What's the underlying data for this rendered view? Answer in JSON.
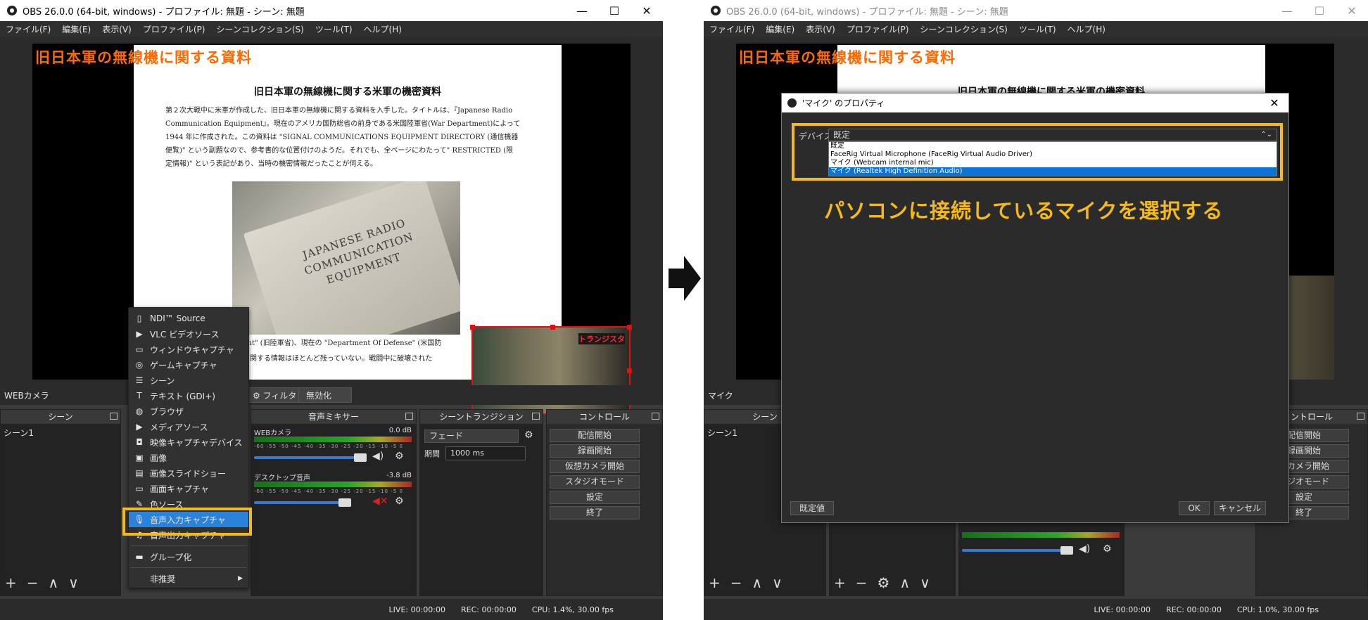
{
  "left": {
    "window_title": "OBS 26.0.0 (64-bit, windows) - プロファイル: 無題 - シーン: 無題",
    "menu": [
      "ファイル(F)",
      "編集(E)",
      "表示(V)",
      "プロファイル(P)",
      "シーンコレクション(S)",
      "ツール(T)",
      "ヘルプ(H)"
    ],
    "overlay_title": "旧日本軍の無線機に関する資料",
    "doc_title": "旧日本軍の無線機に関する米軍の機密資料",
    "doc_lines": [
      "第２次大戦中に米軍が作成した、旧日本軍の無線機に関する資料を入手した。タイトルは、『Japanese Radio",
      "Communication Equipment』。現在のアメリカ国防総省の前身である米国陸軍省(War Department)によって",
      "1944 年に作成された。この資料は \"SIGNAL COMMUNICATIONS EQUIPMENT DIRECTORY (通信機器",
      "便覧)\" という副題なので、参考書的な位置付けのようだ。それでも、全ページにわたって\" RESTRICTED (限",
      "定情報)\" という表記があり、当時の機密情報だったことが伺える。"
    ],
    "photo_text": "JAPANESE RADIO COMMUNICATION EQUIPMENT",
    "doc_bottom_1": "partment\" (旧陸軍省)、現在の \"Department Of Defense\" (米国防",
    "doc_bottom_2": "無線機に関する情報はほとんど残っていない。戦闘中に破壊された",
    "webcam_label": "トランジスタ",
    "source_name": "WEBカメラ",
    "filter_btn": "フィルタ",
    "disable_btn": "無効化",
    "scenes_hdr": "シーン",
    "scene_item": "シーン1",
    "mixer_hdr": "音声ミキサー",
    "mixer": [
      {
        "name": "WEBカメラ",
        "db": "0.0 dB"
      },
      {
        "name": "デスクトップ音声",
        "db": "-3.8 dB"
      }
    ],
    "meter_scale": "-60 -55 -50 -45 -40 -35 -30 -25 -20 -15 -10 -5 0",
    "trans_hdr": "シーントランジション",
    "trans_value": "フェード",
    "duration_label": "期間",
    "duration_value": "1000 ms",
    "ctrl_hdr": "コントロール",
    "controls": [
      "配信開始",
      "録画開始",
      "仮想カメラ開始",
      "スタジオモード",
      "設定",
      "終了"
    ],
    "context_menu": [
      {
        "icon": "▯",
        "label": "NDI™ Source"
      },
      {
        "icon": "▶",
        "label": "VLC ビデオソース"
      },
      {
        "icon": "▭",
        "label": "ウィンドウキャプチャ"
      },
      {
        "icon": "◎",
        "label": "ゲームキャプチャ"
      },
      {
        "icon": "☰",
        "label": "シーン"
      },
      {
        "icon": "T",
        "label": "テキスト (GDI+)"
      },
      {
        "icon": "◍",
        "label": "ブラウザ"
      },
      {
        "icon": "▶",
        "label": "メディアソース"
      },
      {
        "icon": "◘",
        "label": "映像キャプチャデバイス"
      },
      {
        "icon": "▣",
        "label": "画像"
      },
      {
        "icon": "▤",
        "label": "画像スライドショー"
      },
      {
        "icon": "▭",
        "label": "画面キャプチャ"
      },
      {
        "icon": "✎",
        "label": "色ソース"
      },
      {
        "icon": "🎙",
        "label": "音声入力キャプチャ"
      },
      {
        "icon": "♫",
        "label": "音声出力キャプチャ"
      },
      {
        "icon": "▬",
        "label": "グループ化"
      },
      {
        "icon": "",
        "label": "非推奨"
      }
    ],
    "status": {
      "live": "LIVE: 00:00:00",
      "rec": "REC: 00:00:00",
      "cpu": "CPU: 1.4%, 30.00 fps"
    }
  },
  "right": {
    "window_title": "OBS 26.0.0 (64-bit, windows) - プロファイル: 無題 - シーン: 無題",
    "menu": [
      "ファイル(F)",
      "編集(E)",
      "表示(V)",
      "プロファイル(P)",
      "シーンコレクション(S)",
      "ツール(T)",
      "ヘルプ(H)"
    ],
    "overlay_title": "旧日本軍の無線機に関する資料",
    "doc_title": "旧日本軍の無線機に関する米軍の機密資料",
    "source_name": "マイク",
    "scenes_hdr": "シーン",
    "scene_item": "シーン1",
    "ctrl_hdr_partial": "ントロール",
    "controls_partial": [
      "配信開始",
      "録画開始",
      "想カメラ開始",
      "タジオモード",
      "設定",
      "終了"
    ],
    "dialog_title": "'マイク' のプロパティ",
    "device_label": "デバイス",
    "device_selected": "既定",
    "device_options": [
      "既定",
      "FaceRig Virtual Microphone (FaceRig Virtual Audio Driver)",
      "マイク (Webcam internal mic)",
      "マイク (Realtek High Definition Audio)"
    ],
    "caption": "パソコンに接続しているマイクを選択する",
    "defaults_btn": "既定値",
    "ok_btn": "OK",
    "cancel_btn": "キャンセル",
    "status": {
      "live": "LIVE: 00:00:00",
      "rec": "REC: 00:00:00",
      "cpu": "CPU: 1.0%, 30.00 fps"
    }
  },
  "colors": {
    "highlight": "#f4b91a",
    "overlay_title": "#ff6a00",
    "selection": "#2a82da"
  }
}
